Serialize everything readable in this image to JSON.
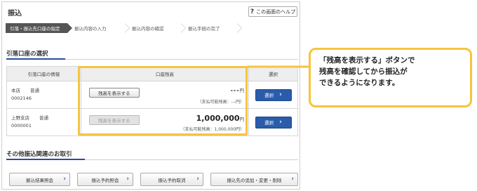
{
  "header": {
    "title": "振込",
    "help_label": "この画面のヘルプ"
  },
  "steps": [
    {
      "label": "引落・振込先口座の指定",
      "active": true
    },
    {
      "label": "振込内容の入力",
      "active": false
    },
    {
      "label": "振込内容の確認",
      "active": false
    },
    {
      "label": "振込手続の完了",
      "active": false
    }
  ],
  "section_account": {
    "title": "引落口座の選択",
    "columns": [
      "引落口座の情報",
      "口座残高",
      "選択"
    ]
  },
  "accounts": [
    {
      "branch": "本店",
      "type": "普通",
      "number": "0002146",
      "show_balance_label": "残高を表示する",
      "show_balance_enabled": true,
      "balance": "---",
      "unit": "円",
      "available": "（支払可能残高：---円）",
      "select_label": "選択"
    },
    {
      "branch": "上野支店",
      "type": "普通",
      "number": "0000001",
      "show_balance_label": "残高を表示する",
      "show_balance_enabled": false,
      "balance": "1,000,000",
      "unit": "円",
      "available": "（支払可能残高：1,000,000円）",
      "select_label": "選択"
    }
  ],
  "section_other": {
    "title": "その他振込関連のお取引"
  },
  "bottom_buttons": [
    {
      "label": "振込結果照会"
    },
    {
      "label": "振込予約照会"
    },
    {
      "label": "振込予約取消"
    },
    {
      "label": "振込先の追加・変更・削除"
    }
  ],
  "callout": {
    "lines": [
      "「残高を表示する」ボタンで",
      "残高を確認してから振込が",
      "できるようになります。"
    ]
  },
  "colors": {
    "highlight": "#f6c43d",
    "primary_button": "#2b5cab",
    "active_step": "#555555"
  }
}
